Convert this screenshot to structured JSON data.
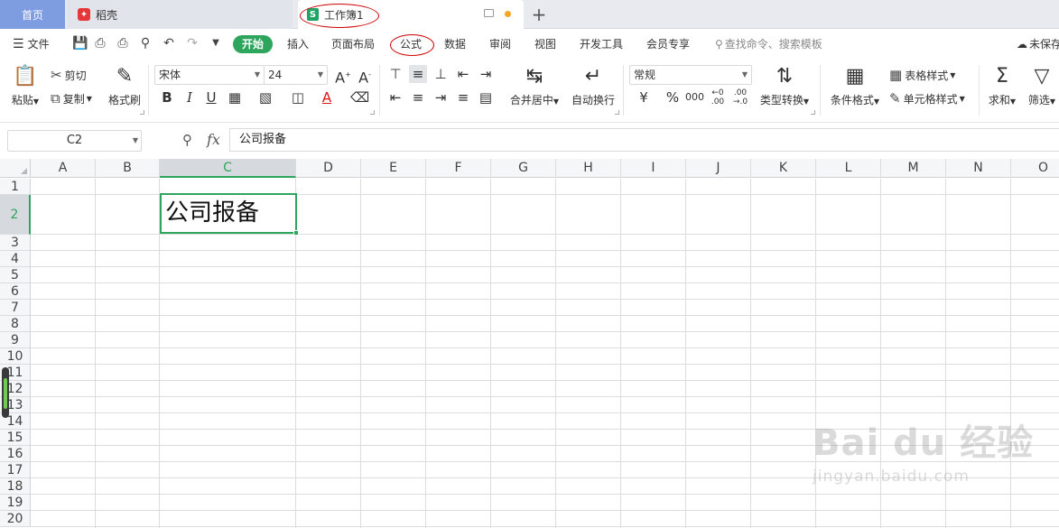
{
  "tabs": {
    "home": "首页",
    "daoke": "稻壳",
    "workbook": "工作簿1",
    "new_tab": "+"
  },
  "menu": {
    "file": "文件",
    "items": [
      "开始",
      "插入",
      "页面布局",
      "公式",
      "数据",
      "审阅",
      "视图",
      "开发工具",
      "会员专享"
    ],
    "search": "查找命令、搜索模板",
    "unsaved": "未保存"
  },
  "ribbon": {
    "paste": "粘贴",
    "cut": "剪切",
    "copy": "复制",
    "format_painter": "格式刷",
    "font_name": "宋体",
    "font_size": "24",
    "merge_center": "合并居中",
    "wrap_text": "自动换行",
    "number_format": "常规",
    "type_convert": "类型转换",
    "conditional_format": "条件格式",
    "table_style": "表格样式",
    "cell_style": "单元格样式",
    "sum": "求和",
    "filter": "筛选",
    "bold": "B",
    "italic": "I",
    "underline": "U"
  },
  "formula_bar": {
    "name_box": "C2",
    "fx": "fx",
    "content": "公司报备"
  },
  "grid": {
    "columns": [
      "A",
      "B",
      "C",
      "D",
      "E",
      "F",
      "G",
      "H",
      "I",
      "J",
      "K",
      "L",
      "M",
      "N",
      "O"
    ],
    "selected_column": "C",
    "rows": [
      "1",
      "2",
      "3",
      "4",
      "5",
      "6",
      "7",
      "8",
      "9",
      "10",
      "11",
      "12",
      "13",
      "14",
      "15",
      "16",
      "17",
      "18",
      "19",
      "20"
    ],
    "selected_row": "2",
    "active_cell_text": "公司报备"
  },
  "watermark": {
    "main": "Bai du 经验",
    "url": "jingyan.baidu.com"
  },
  "colors": {
    "accent": "#2ea55c",
    "annotation": "#cc0000",
    "home_tab": "#7e9ce0"
  }
}
